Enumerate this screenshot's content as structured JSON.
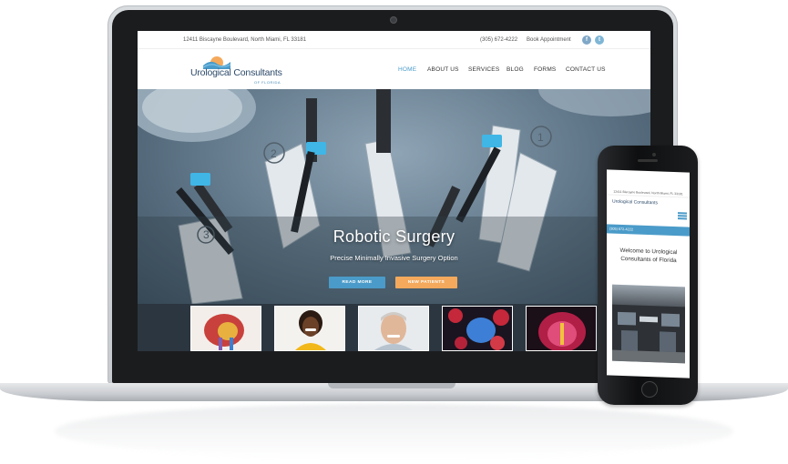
{
  "site": {
    "address": "12411 Biscayne Boulevard, North Miami, FL 33181",
    "phone": "(305) 672-4222",
    "book_label": "Book Appointment",
    "social": [
      "facebook-icon",
      "twitter-icon"
    ],
    "logo_title": "Urological Consultants",
    "logo_subtitle": "OF FLORIDA",
    "nav": [
      "HOME",
      "ABOUT US",
      "SERVICES",
      "BLOG",
      "FORMS",
      "CONTACT US"
    ],
    "active_nav": "HOME",
    "hero_title": "Robotic Surgery",
    "hero_subtitle": "Precise Minimally Invasive Surgery Option",
    "read_more": "READ MORE",
    "new_patients": "NEW PATIENTS"
  },
  "mobile": {
    "address": "12411 Biscayne Boulevard, North Miami, FL 33181",
    "logo_title": "Urological Consultants",
    "phone": "(305) 672-4222",
    "welcome": "Welcome to Urological Consultants of Florida"
  },
  "colors": {
    "accent_blue": "#4a9bc9",
    "accent_orange": "#f5a95c",
    "logo_navy": "#2d4a6a"
  }
}
